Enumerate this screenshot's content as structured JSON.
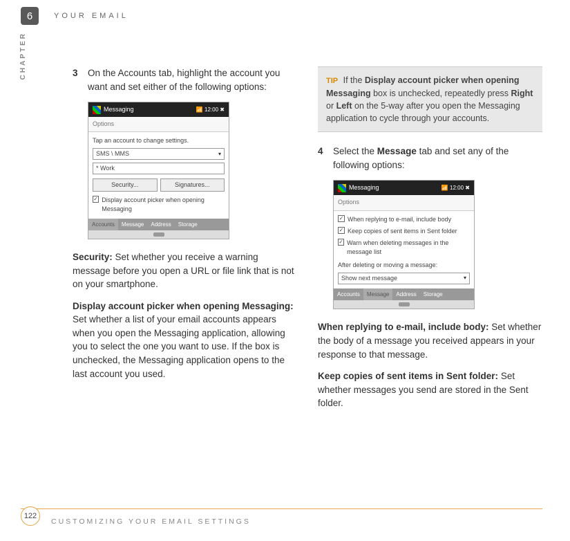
{
  "header": {
    "chapter_num": "6",
    "title": "YOUR EMAIL",
    "chapter_label": "CHAPTER"
  },
  "left": {
    "step3_num": "3",
    "step3_text": "On the Accounts tab, highlight the account you want and set either of the following options:",
    "mock1": {
      "title": "Messaging",
      "status_icons": "📶  12:00  ✖",
      "options_label": "Options",
      "instruction": "Tap an account to change settings.",
      "acct1": "SMS \\ MMS",
      "acct2": "* Work",
      "btn_security": "Security...",
      "btn_signatures": "Signatures...",
      "checkbox_label": "Display account picker when opening Messaging",
      "tabs_label": "Accounts",
      "tab2": "Message",
      "tab3": "Address",
      "tab4": "Storage"
    },
    "security_label": "Security:",
    "security_text": " Set whether you receive a warning message before you open a URL or file link that is not on your smartphone.",
    "display_label": "Display account picker when opening Messaging:",
    "display_text": " Set whether a list of your email accounts appears when you open the Messaging application, allowing you to select the one you want to use. If the box is unchecked, the Messaging application opens to the last account you used."
  },
  "right": {
    "tip_label": "TIP",
    "tip_pre": " If the ",
    "tip_bold1": "Display account picker when opening Messaging",
    "tip_mid1": " box is unchecked, repeatedly press ",
    "tip_bold2": "Right",
    "tip_mid2": " or ",
    "tip_bold3": "Left",
    "tip_post": " on the 5-way after you open the Messaging application to cycle through your accounts.",
    "step4_num": "4",
    "step4_pre": "Select the ",
    "step4_bold": "Message",
    "step4_post": " tab and set any of the following options:",
    "mock2": {
      "title": "Messaging",
      "status_icons": "📶  12:00  ✖",
      "options_label": "Options",
      "chk1": "When replying to e-mail, include body",
      "chk2": "Keep copies of sent items in Sent folder",
      "chk3": "Warn when deleting messages in the message list",
      "after_label": "After deleting or moving a message:",
      "select_value": "Show next message",
      "tabs_label": "Accounts",
      "tab2": "Message",
      "tab3": "Address",
      "tab4": "Storage"
    },
    "reply_label": "When replying to e-mail, include body:",
    "reply_text": " Set whether the body of a message you received appears in your response to that message.",
    "keep_label": "Keep copies of sent items in Sent folder:",
    "keep_text": " Set whether messages you send are stored in the Sent folder."
  },
  "footer": {
    "page": "122",
    "title": "CUSTOMIZING YOUR EMAIL SETTINGS"
  }
}
